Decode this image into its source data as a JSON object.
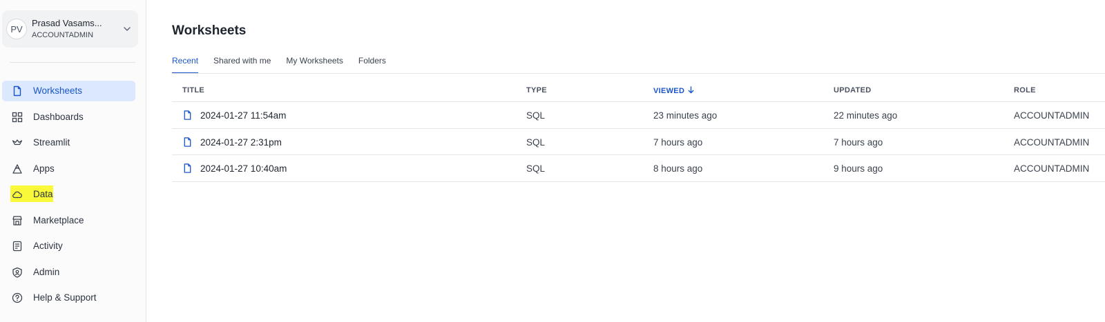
{
  "user": {
    "initials": "PV",
    "name": "Prasad Vasams...",
    "role": "ACCOUNTADMIN"
  },
  "sidebar": {
    "items": [
      {
        "label": "Worksheets",
        "icon": "document-icon"
      },
      {
        "label": "Dashboards",
        "icon": "grid-icon"
      },
      {
        "label": "Streamlit",
        "icon": "crown-icon"
      },
      {
        "label": "Apps",
        "icon": "apps-icon"
      },
      {
        "label": "Data",
        "icon": "cloud-icon"
      },
      {
        "label": "Marketplace",
        "icon": "store-icon"
      },
      {
        "label": "Activity",
        "icon": "activity-icon"
      },
      {
        "label": "Admin",
        "icon": "shield-icon"
      },
      {
        "label": "Help & Support",
        "icon": "help-icon"
      }
    ],
    "active": "Worksheets",
    "highlighted": "Data"
  },
  "main": {
    "title": "Worksheets",
    "tabs": [
      {
        "label": "Recent"
      },
      {
        "label": "Shared with me"
      },
      {
        "label": "My Worksheets"
      },
      {
        "label": "Folders"
      }
    ],
    "active_tab": "Recent"
  },
  "table": {
    "columns": {
      "title": "TITLE",
      "type": "TYPE",
      "viewed": "VIEWED",
      "updated": "UPDATED",
      "role": "ROLE"
    },
    "sorted_by": "VIEWED",
    "sort_direction": "descending",
    "rows": [
      {
        "title": "2024-01-27 11:54am",
        "type": "SQL",
        "viewed": "23 minutes ago",
        "updated": "22 minutes ago",
        "role": "ACCOUNTADMIN"
      },
      {
        "title": "2024-01-27 2:31pm",
        "type": "SQL",
        "viewed": "7 hours ago",
        "updated": "7 hours ago",
        "role": "ACCOUNTADMIN"
      },
      {
        "title": "2024-01-27 10:40am",
        "type": "SQL",
        "viewed": "8 hours ago",
        "updated": "9 hours ago",
        "role": "ACCOUNTADMIN"
      }
    ]
  },
  "colors": {
    "accent": "#1a56c8",
    "active_bg": "#dbe8fd",
    "highlight": "#f9f93a"
  }
}
